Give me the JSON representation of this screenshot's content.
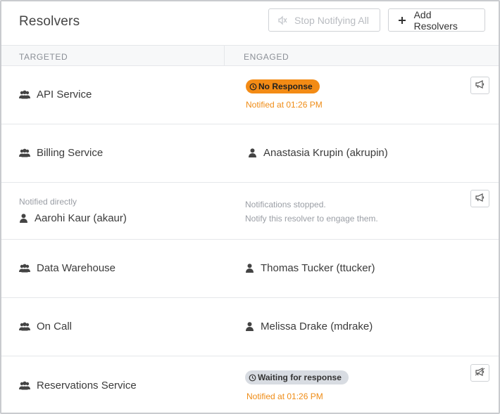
{
  "header": {
    "title": "Resolvers",
    "stop_label": "Stop Notifying All",
    "add_label": "Add Resolvers"
  },
  "columns": {
    "targeted": "TARGETED",
    "engaged": "ENGAGED"
  },
  "rows": [
    {
      "target": "API Service",
      "type": "team",
      "badge": "No Response",
      "notified": "Notified at 01:26 PM"
    },
    {
      "target": "Billing Service",
      "type": "team",
      "engaged_user": "Anastasia Krupin (akrupin)"
    },
    {
      "target": "Aarohi Kaur (akaur)",
      "type": "user",
      "sub": "Notified directly",
      "stopped_line1": "Notifications stopped.",
      "stopped_line2": "Notify this resolver to engage them."
    },
    {
      "target": "Data Warehouse",
      "type": "team",
      "engaged_user": "Thomas Tucker (ttucker)"
    },
    {
      "target": "On Call",
      "type": "team",
      "engaged_user": "Melissa Drake (mdrake)"
    },
    {
      "target": "Reservations Service",
      "type": "team",
      "badge": "Waiting for response",
      "notified": "Notified at 01:26 PM"
    }
  ],
  "icons": {
    "team": "users-icon",
    "user": "user-icon",
    "notify": "megaphone-icon",
    "add": "plus-icon",
    "stop": "mute-icon",
    "badge": "clock-icon"
  },
  "colors": {
    "accent_orange": "#f38b15",
    "notified_text": "#ef8c16",
    "badge_grey": "#d8dce2"
  }
}
